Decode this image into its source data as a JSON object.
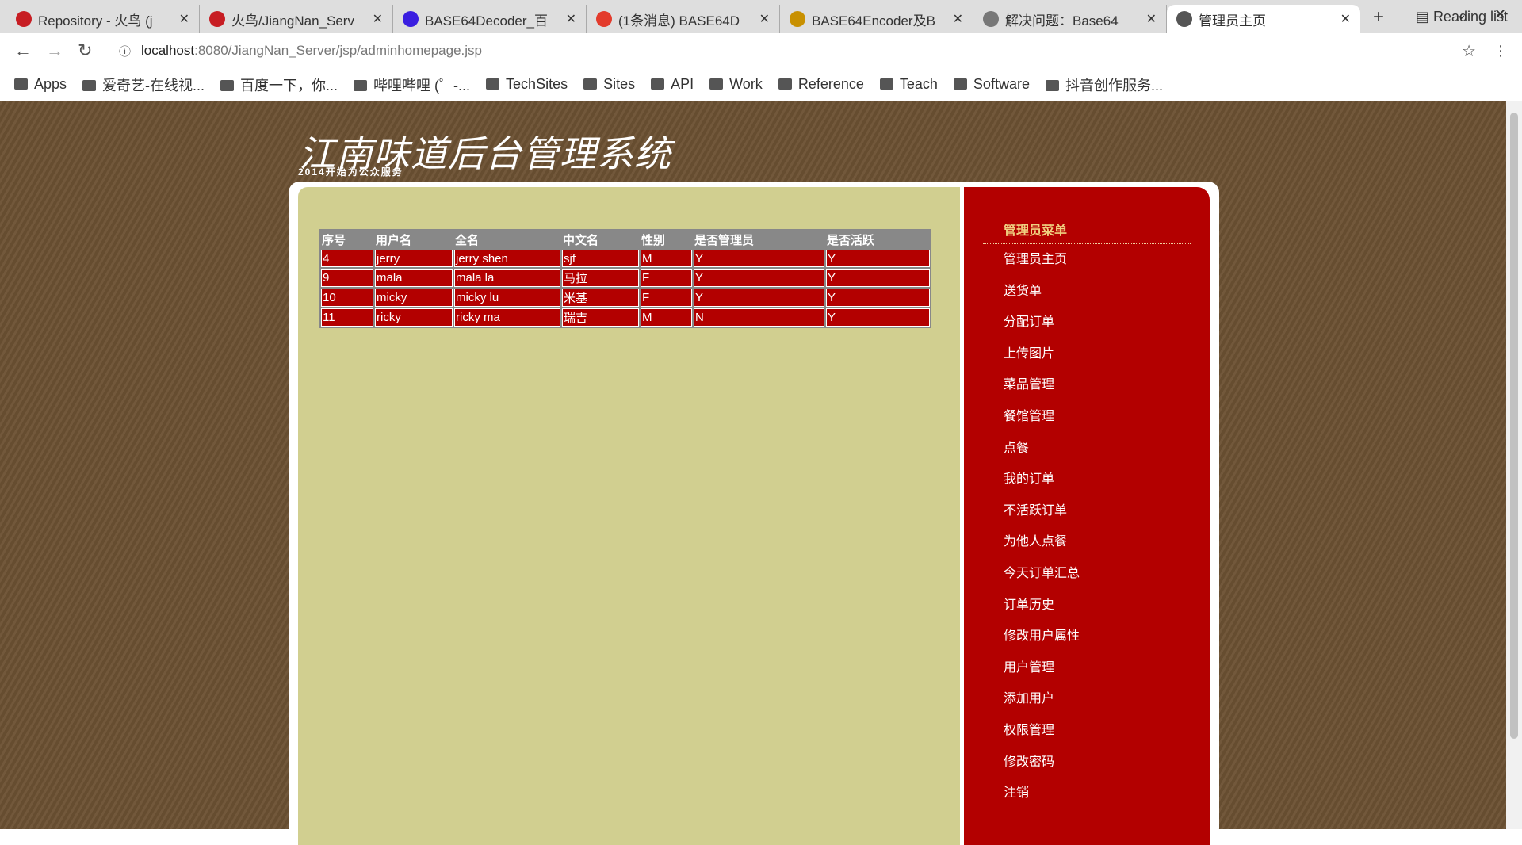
{
  "browser": {
    "tabs": [
      {
        "title": "Repository - 火鸟 (j",
        "icon": "gitee-icon",
        "color": "#c71d23"
      },
      {
        "title": "火鸟/JiangNan_Serv",
        "icon": "gitee-icon",
        "color": "#c71d23"
      },
      {
        "title": "BASE64Decoder_百",
        "icon": "baidu-paw-icon",
        "color": "#3a1ee0"
      },
      {
        "title": "(1条消息) BASE64D",
        "icon": "csdn-icon",
        "color": "#e33b2c"
      },
      {
        "title": "BASE64Encoder及B",
        "icon": "site-icon",
        "color": "#c89000"
      },
      {
        "title": "解决问题：Base64",
        "icon": "site-icon",
        "color": "#777777"
      },
      {
        "title": "管理员主页",
        "icon": "globe-icon",
        "color": "#555555"
      }
    ],
    "url_host": "localhost",
    "url_rest": ":8080/JiangNan_Server/jsp/adminhomepage.jsp",
    "bookmarks": [
      "Apps",
      "爱奇艺-在线视...",
      "百度一下，你...",
      "哔哩哔哩 (゜-...",
      "TechSites",
      "Sites",
      "API",
      "Work",
      "Reference",
      "Teach",
      "Software",
      "抖音创作服务..."
    ],
    "reading_list": "Reading list"
  },
  "header": {
    "title": "江南味道后台管理系统",
    "subtitle": "2014开始为公众服务"
  },
  "table": {
    "columns": [
      "序号",
      "用户名",
      "全名",
      "中文名",
      "性别",
      "是否管理员",
      "是否活跃"
    ],
    "rows": [
      [
        "4",
        "jerry",
        "jerry shen",
        "sjf",
        "M",
        "Y",
        "Y"
      ],
      [
        "9",
        "mala",
        "mala la",
        "马拉",
        "F",
        "Y",
        "Y"
      ],
      [
        "10",
        "micky",
        "micky lu",
        "米基",
        "F",
        "Y",
        "Y"
      ],
      [
        "11",
        "ricky",
        "ricky ma",
        "瑞吉",
        "M",
        "N",
        "Y"
      ]
    ]
  },
  "menu": {
    "heading": "管理员菜单",
    "items": [
      "管理员主页",
      "送货单",
      "分配订单",
      "上传图片",
      "菜品管理",
      "餐馆管理",
      "点餐",
      "我的订单",
      "不活跃订单",
      "为他人点餐",
      "今天订单汇总",
      "订单历史",
      "修改用户属性",
      "用户管理",
      "添加用户",
      "权限管理",
      "修改密码",
      "注销"
    ]
  },
  "colors": {
    "background": "#6c5133",
    "main": "#d1cf90",
    "sidebar": "#b30000",
    "menu_heading": "#f0d080"
  }
}
